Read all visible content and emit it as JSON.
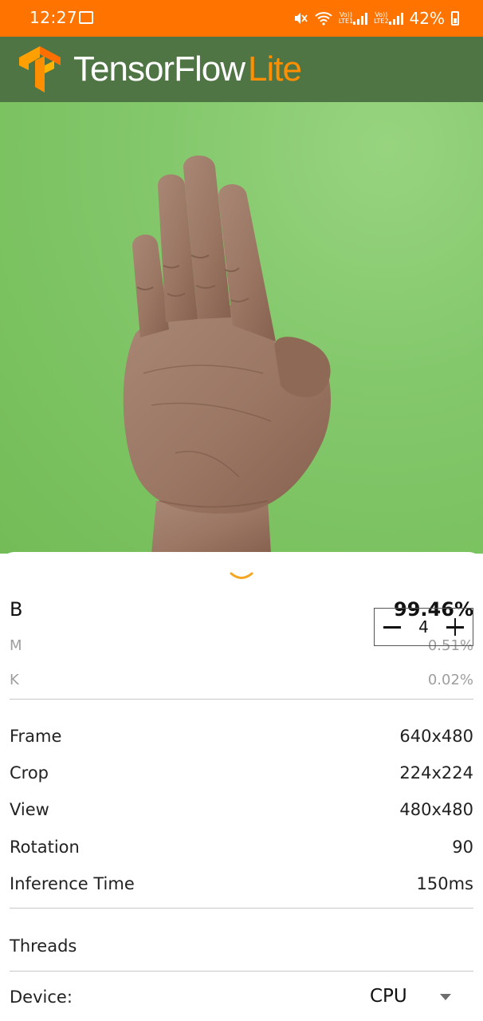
{
  "status_bar": {
    "time": "12:27",
    "battery": "42%",
    "sim1": "LTE1",
    "sim2": "LTE2",
    "volte": "Vo))"
  },
  "app_bar": {
    "brand_main": "TensorFlow",
    "brand_accent": "Lite",
    "brand_main_color": "#ffffff",
    "brand_accent_color": "#ff8f00",
    "bar_color": "#4f7545",
    "status_bar_color": "#ff7400"
  },
  "camera_preview": {
    "subject": "hand-sign",
    "background_color": "#7fc465"
  },
  "predictions": [
    {
      "label": "B",
      "confidence": "99.46%"
    },
    {
      "label": "M",
      "confidence": "0.51%"
    },
    {
      "label": "K",
      "confidence": "0.02%"
    }
  ],
  "info": [
    {
      "label": "Frame",
      "value": "640x480"
    },
    {
      "label": "Crop",
      "value": "224x224"
    },
    {
      "label": "View",
      "value": "480x480"
    },
    {
      "label": "Rotation",
      "value": "90"
    },
    {
      "label": "Inference Time",
      "value": "150ms"
    }
  ],
  "threads": {
    "label": "Threads",
    "value": "4"
  },
  "device": {
    "label": "Device:",
    "value": "CPU"
  },
  "accent_color": "#f5a623",
  "icons": {
    "collapse": "chevron-down-icon",
    "decrement": "minus-icon",
    "increment": "plus-icon",
    "dropdown": "caret-down-icon"
  }
}
